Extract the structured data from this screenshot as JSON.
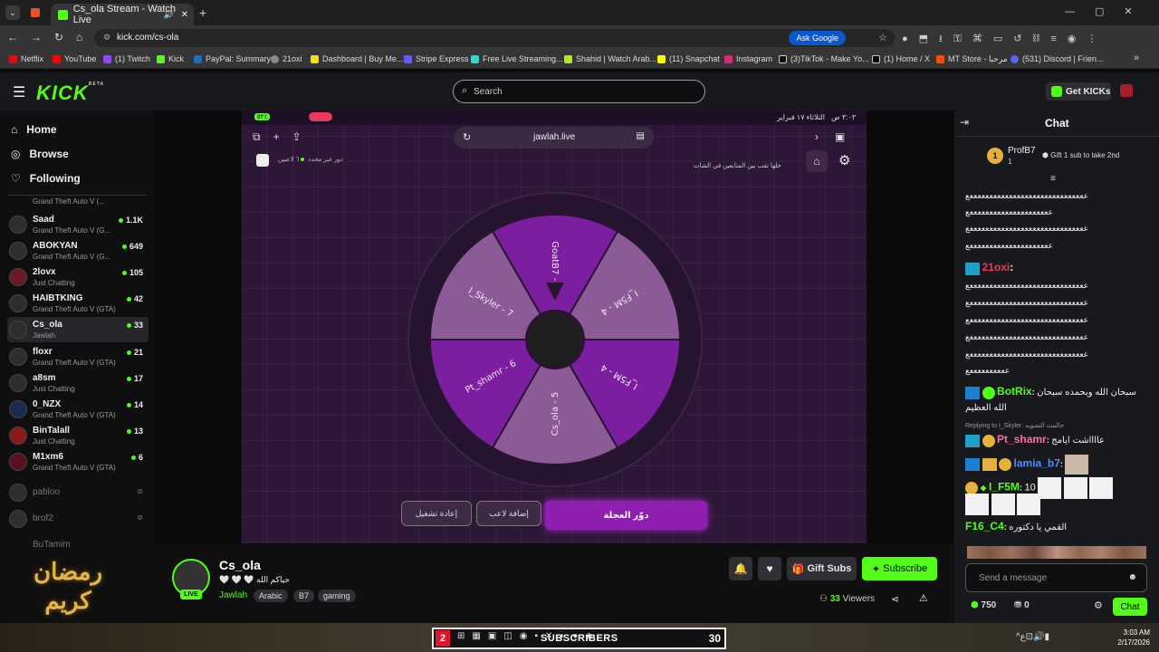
{
  "browser": {
    "tab_title": "Cs_ola Stream - Watch Live",
    "url": "kick.com/cs-ola",
    "ask_google": "Ask Google",
    "bookmarks": [
      "Netflix",
      "YouTube",
      "(1) Twitch",
      "Kick",
      "PayPal: Summary",
      "21oxi",
      "Dashboard | Buy Me...",
      "Stripe Express",
      "Free Live Streaming...",
      "Shahid | Watch Arab...",
      "(11) Snapchat",
      "Instagram",
      "(3)TikTok - Make Yo...",
      "(1) Home / X",
      "MT Store - مرحبا",
      "(531) Discord | Frien..."
    ]
  },
  "header": {
    "logo": "KICK",
    "logo_beta": "BETA",
    "search_placeholder": "Search",
    "get_kicks": "Get KICKs"
  },
  "sidebar": {
    "nav": [
      "Home",
      "Browse",
      "Following"
    ],
    "channels": [
      {
        "name": "",
        "game": "Grand Theft Auto V (...",
        "viewers": ""
      },
      {
        "name": "Saad",
        "game": "Grand Theft Auto V (G...",
        "viewers": "1.1K"
      },
      {
        "name": "ABOKYAN",
        "game": "Grand Theft Auto V (G...",
        "viewers": "649"
      },
      {
        "name": "2lovx",
        "game": "Just Chatting",
        "viewers": "105"
      },
      {
        "name": "HAIBTKING",
        "game": "Grand Theft Auto V (GTA)",
        "viewers": "42"
      },
      {
        "name": "Cs_ola",
        "game": "Jawlah",
        "viewers": "33"
      },
      {
        "name": "floxr",
        "game": "Grand Theft Auto V (GTA)",
        "viewers": "21"
      },
      {
        "name": "a8sm",
        "game": "Just Chatting",
        "viewers": "17"
      },
      {
        "name": "0_NZX",
        "game": "Grand Theft Auto V (GTA)",
        "viewers": "14"
      },
      {
        "name": "BinTalall",
        "game": "Just Chatting",
        "viewers": "13"
      },
      {
        "name": "M1xm6",
        "game": "Grand Theft Auto V (GTA)",
        "viewers": "6"
      }
    ],
    "offline": [
      "pabloo",
      "brof2",
      "BuTamim"
    ],
    "ramadan": "رمضان كريم"
  },
  "player": {
    "status_time": "٣:٠٣ ص",
    "status_date": "الثلاثاء ١٧ فبراير",
    "battery": "٥٢٪",
    "site": "jawlah.live",
    "subtitle": "خلها تقب بين المتابعين في الشات",
    "players_count": "٦ لاعبين",
    "turn_label": "دور غير محدد",
    "wheel_segments": [
      "GoatB7 - 6",
      "I_F5M - 4",
      "I_F5M - 4",
      "Cs_ola - 5",
      "Pt_shamr - 6",
      "I_Skyler - 7"
    ],
    "spin_button": "دوّر العجلة",
    "add_player_button": "إضافة لاعب",
    "restart_button": "إعادة تشغيل"
  },
  "stream_info": {
    "streamer": "Cs_ola",
    "title": "حياكم الله 🤍 🤍 🤍",
    "live": "LIVE",
    "category": "Jawlah",
    "tags": [
      "Arabic",
      "B7",
      "gaming"
    ],
    "gift_subs": "Gift Subs",
    "subscribe": "Subscribe",
    "viewers": "33",
    "viewers_label": "Viewers"
  },
  "chat": {
    "title": "Chat",
    "pinned_user": "ProfB7",
    "pinned_count": "1",
    "pinned_msg": "Gift 1 sub to take 2nd",
    "spam_line": "ععععععععععععععععععععععععععععععع",
    "spam_line_short": "عععععععععععععععععععععع",
    "spam_line_tail": "ععععععععععع",
    "messages": [
      {
        "user": "21oxi",
        "text": ""
      },
      {
        "user": "BotRix",
        "text": "سبحان الله وبحمده سبحان الله العظيم"
      },
      {
        "user": "Pt_shamr",
        "text": "عااااشت ايامج",
        "reply": "Replying to I_Skyler: حالمت التصويه"
      },
      {
        "user": "lamia_b7",
        "text": ""
      },
      {
        "user": "I_F5M",
        "text": "10"
      },
      {
        "user": "F16_C4",
        "text": "القمي يا دكتوره"
      }
    ],
    "input_placeholder": "Send a message",
    "kicks_balance": "750",
    "points": "0",
    "chat_button": "Chat"
  },
  "taskbar": {
    "badge": "2",
    "subscribers_label": "SUBSCRIBERS",
    "subscribers_count": "30",
    "time": "3:03 AM",
    "date": "2/17/2026"
  }
}
